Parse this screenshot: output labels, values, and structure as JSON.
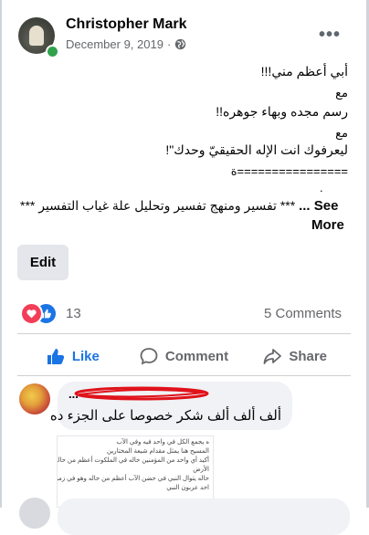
{
  "post": {
    "author": "Christopher Mark",
    "date": "December 9, 2019",
    "separator": "·",
    "privacy_icon": "globe-icon",
    "more_icon": "more-horizontal-icon",
    "more_label": "•••",
    "lines": [
      "أبي أعظم مني!!!",
      "مع",
      "رسم مجده وبهاء جوهره!!",
      "مع",
      "ليعرفوك انت الإله الحقيقيّ وحدك\"!",
      "================ة"
    ],
    "dot_line": ".",
    "arabic_tail": "*** تفسير ومنهج تفسير وتحليل علة غياب التفسير ***",
    "see_more_prefix": "... See",
    "see_more_suffix": "More",
    "edit_label": "Edit"
  },
  "reactions": {
    "icons": [
      "love-icon",
      "like-icon"
    ],
    "count": "13",
    "comments": "5 Comments"
  },
  "actions": {
    "like": "Like",
    "comment": "Comment",
    "share": "Share"
  },
  "comment": {
    "name": "...",
    "text": "ألف ألف ألف شكر خصوصا على الجزء ده",
    "image_lines": [
      "ه يجمع الكل في واحد فيه وفي الآب",
      "المسيح هنا يمثل مقدام شيعة المختارين",
      "أكيد أي واحد من المؤمنين حاله في الملكوت أعظم من حاله في",
      "الأرض",
      "حاله يتوال النبي في حضن الآب أعظم من حاله وهو في زمن",
      "احد عربون النبي"
    ]
  },
  "colors": {
    "accent": "#1b74e4",
    "love": "#f33e58",
    "online": "#31a24c",
    "muted": "#65676b"
  }
}
